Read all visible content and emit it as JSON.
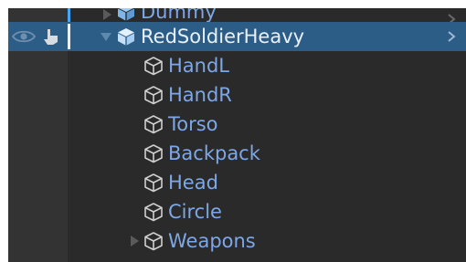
{
  "hierarchy": {
    "rows": [
      {
        "label": "Dummy",
        "depth": 0,
        "expand": "collapsed",
        "icon": "prefab-cube-icon",
        "selected": false,
        "has_chevron": true
      },
      {
        "label": "RedSoldierHeavy",
        "depth": 0,
        "expand": "expanded",
        "icon": "prefab-cube-icon",
        "selected": true,
        "has_chevron": true
      },
      {
        "label": "HandL",
        "depth": 1,
        "expand": "none",
        "icon": "gameobject-cube-icon",
        "selected": false,
        "has_chevron": false
      },
      {
        "label": "HandR",
        "depth": 1,
        "expand": "none",
        "icon": "gameobject-cube-icon",
        "selected": false,
        "has_chevron": false
      },
      {
        "label": "Torso",
        "depth": 1,
        "expand": "none",
        "icon": "gameobject-cube-icon",
        "selected": false,
        "has_chevron": false
      },
      {
        "label": "Backpack",
        "depth": 1,
        "expand": "none",
        "icon": "gameobject-cube-icon",
        "selected": false,
        "has_chevron": false
      },
      {
        "label": "Head",
        "depth": 1,
        "expand": "none",
        "icon": "gameobject-cube-icon",
        "selected": false,
        "has_chevron": false
      },
      {
        "label": "Circle",
        "depth": 1,
        "expand": "none",
        "icon": "gameobject-cube-icon",
        "selected": false,
        "has_chevron": false
      },
      {
        "label": "Weapons",
        "depth": 1,
        "expand": "collapsed",
        "icon": "gameobject-cube-icon",
        "selected": false,
        "has_chevron": false
      }
    ]
  },
  "colors": {
    "panel_background": "#2a2a2a",
    "gutter_background": "#333333",
    "selection_background": "#2c5d87",
    "label_text": "#7da7e6",
    "selected_label_text": "#e8f1fb",
    "prefab_icon": "#8fc3f5",
    "accent_bar": "#45a7f4"
  }
}
